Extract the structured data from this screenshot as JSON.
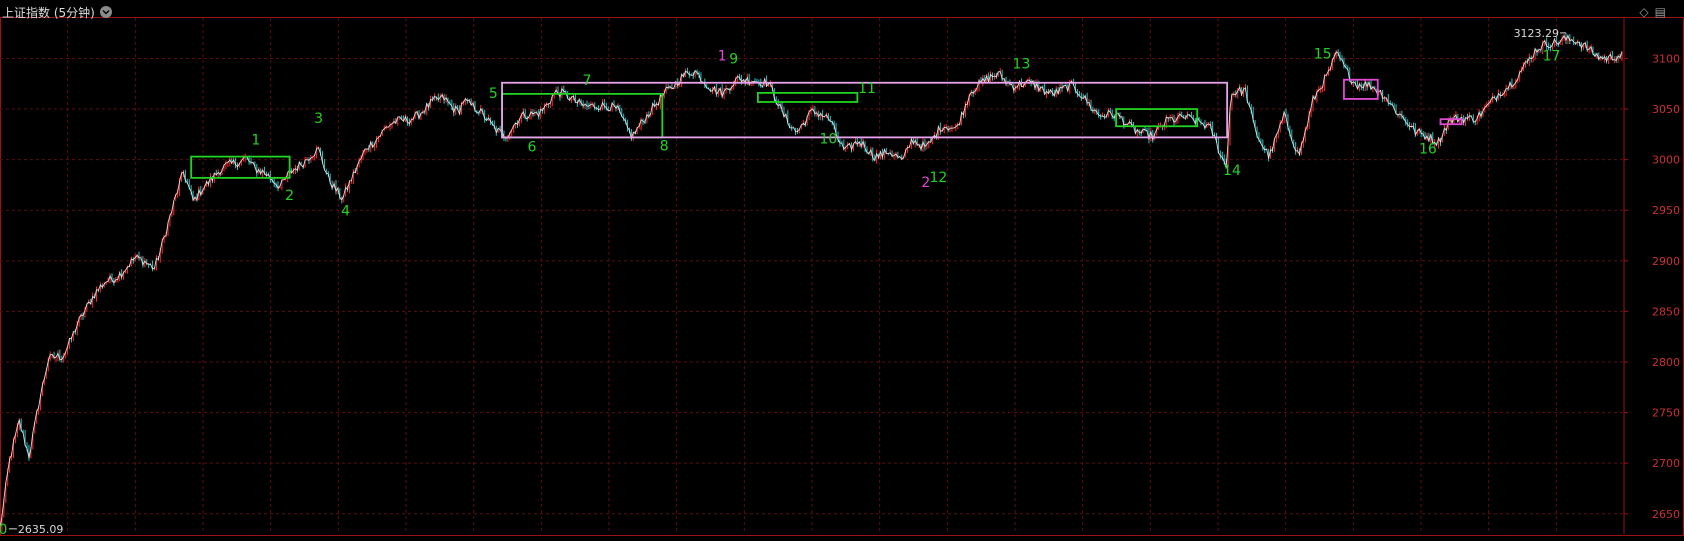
{
  "title": "上证指数 (5分钟)",
  "chart_data": {
    "type": "line",
    "ylim": [
      2630,
      3140
    ],
    "y_ticks": [
      "3100",
      "3050",
      "3000",
      "2950",
      "2900",
      "2850",
      "2800",
      "2750",
      "2700",
      "2650"
    ],
    "x_bars": [
      0,
      1680
    ],
    "price_path": [
      [
        0,
        2635
      ],
      [
        10,
        2700
      ],
      [
        20,
        2740
      ],
      [
        30,
        2710
      ],
      [
        40,
        2760
      ],
      [
        50,
        2800
      ],
      [
        65,
        2805
      ],
      [
        80,
        2840
      ],
      [
        95,
        2860
      ],
      [
        110,
        2880
      ],
      [
        125,
        2890
      ],
      [
        140,
        2900
      ],
      [
        160,
        2895
      ],
      [
        175,
        2940
      ],
      [
        190,
        2985
      ],
      [
        200,
        2960
      ],
      [
        210,
        2975
      ],
      [
        225,
        2985
      ],
      [
        240,
        2995
      ],
      [
        255,
        3005
      ],
      [
        265,
        2990
      ],
      [
        280,
        2980
      ],
      [
        290,
        2975
      ],
      [
        300,
        2990
      ],
      [
        315,
        2995
      ],
      [
        330,
        3010
      ],
      [
        340,
        2985
      ],
      [
        355,
        2960
      ],
      [
        365,
        2980
      ],
      [
        380,
        3015
      ],
      [
        400,
        3030
      ],
      [
        420,
        3040
      ],
      [
        440,
        3050
      ],
      [
        460,
        3060
      ],
      [
        475,
        3050
      ],
      [
        480,
        3060
      ],
      [
        490,
        3050
      ],
      [
        510,
        3035
      ],
      [
        525,
        3025
      ],
      [
        540,
        3040
      ],
      [
        560,
        3050
      ],
      [
        575,
        3065
      ],
      [
        590,
        3060
      ],
      [
        610,
        3055
      ],
      [
        625,
        3050
      ],
      [
        640,
        3050
      ],
      [
        655,
        3025
      ],
      [
        670,
        3040
      ],
      [
        690,
        3070
      ],
      [
        705,
        3080
      ],
      [
        720,
        3085
      ],
      [
        735,
        3075
      ],
      [
        750,
        3065
      ],
      [
        765,
        3078
      ],
      [
        780,
        3082
      ],
      [
        795,
        3075
      ],
      [
        810,
        3045
      ],
      [
        825,
        3030
      ],
      [
        840,
        3045
      ],
      [
        860,
        3040
      ],
      [
        875,
        3010
      ],
      [
        890,
        3015
      ],
      [
        905,
        3005
      ],
      [
        920,
        3010
      ],
      [
        935,
        2995
      ],
      [
        945,
        3020
      ],
      [
        960,
        3015
      ],
      [
        975,
        3030
      ],
      [
        990,
        3030
      ],
      [
        1005,
        3070
      ],
      [
        1020,
        3075
      ],
      [
        1035,
        3085
      ],
      [
        1050,
        3075
      ],
      [
        1070,
        3072
      ],
      [
        1090,
        3068
      ],
      [
        1110,
        3070
      ],
      [
        1125,
        3060
      ],
      [
        1140,
        3045
      ],
      [
        1160,
        3040
      ],
      [
        1180,
        3030
      ],
      [
        1195,
        3020
      ],
      [
        1210,
        3040
      ],
      [
        1225,
        3045
      ],
      [
        1240,
        3035
      ],
      [
        1255,
        3030
      ],
      [
        1270,
        2995
      ],
      [
        1275,
        3065
      ],
      [
        1290,
        3065
      ],
      [
        1300,
        3030
      ],
      [
        1315,
        3005
      ],
      [
        1330,
        3040
      ],
      [
        1345,
        3005
      ],
      [
        1360,
        3060
      ],
      [
        1375,
        3080
      ],
      [
        1385,
        3105
      ],
      [
        1395,
        3090
      ],
      [
        1405,
        3075
      ],
      [
        1420,
        3070
      ],
      [
        1435,
        3065
      ],
      [
        1450,
        3045
      ],
      [
        1465,
        3025
      ],
      [
        1480,
        3025
      ],
      [
        1490,
        3020
      ],
      [
        1500,
        3035
      ],
      [
        1515,
        3040
      ],
      [
        1530,
        3045
      ],
      [
        1545,
        3055
      ],
      [
        1560,
        3070
      ],
      [
        1575,
        3090
      ],
      [
        1590,
        3105
      ],
      [
        1605,
        3115
      ],
      [
        1620,
        3122
      ],
      [
        1632,
        3116
      ],
      [
        1640,
        3110
      ],
      [
        1652,
        3105
      ],
      [
        1680,
        3100
      ]
    ],
    "annotations": {
      "labels": [
        {
          "text": "0",
          "x": 3,
          "y": 2630,
          "color": "#21d421"
        },
        {
          "text": "1",
          "x": 265,
          "y": 3015,
          "color": "#21d421"
        },
        {
          "text": "2",
          "x": 300,
          "y": 2960,
          "color": "#21d421"
        },
        {
          "text": "3",
          "x": 330,
          "y": 3036,
          "color": "#21d421"
        },
        {
          "text": "4",
          "x": 358,
          "y": 2945,
          "color": "#21d421"
        },
        {
          "text": "5",
          "x": 511,
          "y": 3061,
          "color": "#21d421"
        },
        {
          "text": "6",
          "x": 551,
          "y": 3008,
          "color": "#21d421"
        },
        {
          "text": "7",
          "x": 608,
          "y": 3074,
          "color": "#21d421"
        },
        {
          "text": "8",
          "x": 688,
          "y": 3009,
          "color": "#21d421"
        },
        {
          "text": "9",
          "x": 760,
          "y": 3095,
          "color": "#21d421"
        },
        {
          "text": "10",
          "x": 858,
          "y": 3016,
          "color": "#21d421"
        },
        {
          "text": "11",
          "x": 898,
          "y": 3066,
          "color": "#21d421"
        },
        {
          "text": "12",
          "x": 972,
          "y": 2978,
          "color": "#21d421"
        },
        {
          "text": "13",
          "x": 1058,
          "y": 3090,
          "color": "#21d421"
        },
        {
          "text": "14",
          "x": 1276,
          "y": 2985,
          "color": "#21d421"
        },
        {
          "text": "15",
          "x": 1370,
          "y": 3100,
          "color": "#21d421"
        },
        {
          "text": "16",
          "x": 1479,
          "y": 3006,
          "color": "#21d421"
        },
        {
          "text": "17",
          "x": 1607,
          "y": 3098,
          "color": "#21d421"
        },
        {
          "text": "1",
          "x": 748,
          "y": 3098,
          "color": "#e04bd6"
        },
        {
          "text": "2",
          "x": 959,
          "y": 2973,
          "color": "#e04bd6"
        }
      ],
      "boxes": [
        {
          "x0": 198,
          "x1": 300,
          "y0": 2982,
          "y1": 3003,
          "color": "#21d421"
        },
        {
          "x0": 520,
          "x1": 686,
          "y0": 3022,
          "y1": 3065,
          "color": "#21d421"
        },
        {
          "x0": 785,
          "x1": 888,
          "y0": 3057,
          "y1": 3066,
          "color": "#21d421"
        },
        {
          "x0": 1156,
          "x1": 1240,
          "y0": 3033,
          "y1": 3050,
          "color": "#21d421"
        },
        {
          "x0": 520,
          "x1": 1271,
          "y0": 3022,
          "y1": 3076,
          "color": "#e8a3ec"
        },
        {
          "x0": 1392,
          "x1": 1427,
          "y0": 3060,
          "y1": 3079,
          "color": "#e04bd6"
        },
        {
          "x0": 1492,
          "x1": 1514,
          "y0": 3035,
          "y1": 3040,
          "color": "#e04bd6"
        }
      ]
    },
    "high_label": {
      "text": "3123.29",
      "x": 1620,
      "y": 3123.29
    },
    "low_label": {
      "text": "2635.09",
      "x": 3,
      "y": 2635.09
    }
  },
  "colors": {
    "background": "#000000",
    "grid": "#5a0f0f",
    "axis_text": "#c83232",
    "line": "#f0f0f0",
    "up_tick": "#ff2a2a",
    "down_tick": "#2cc4c4",
    "border": "#9a1212"
  },
  "icons": {
    "corner_1": "◇",
    "corner_2": "▤"
  }
}
